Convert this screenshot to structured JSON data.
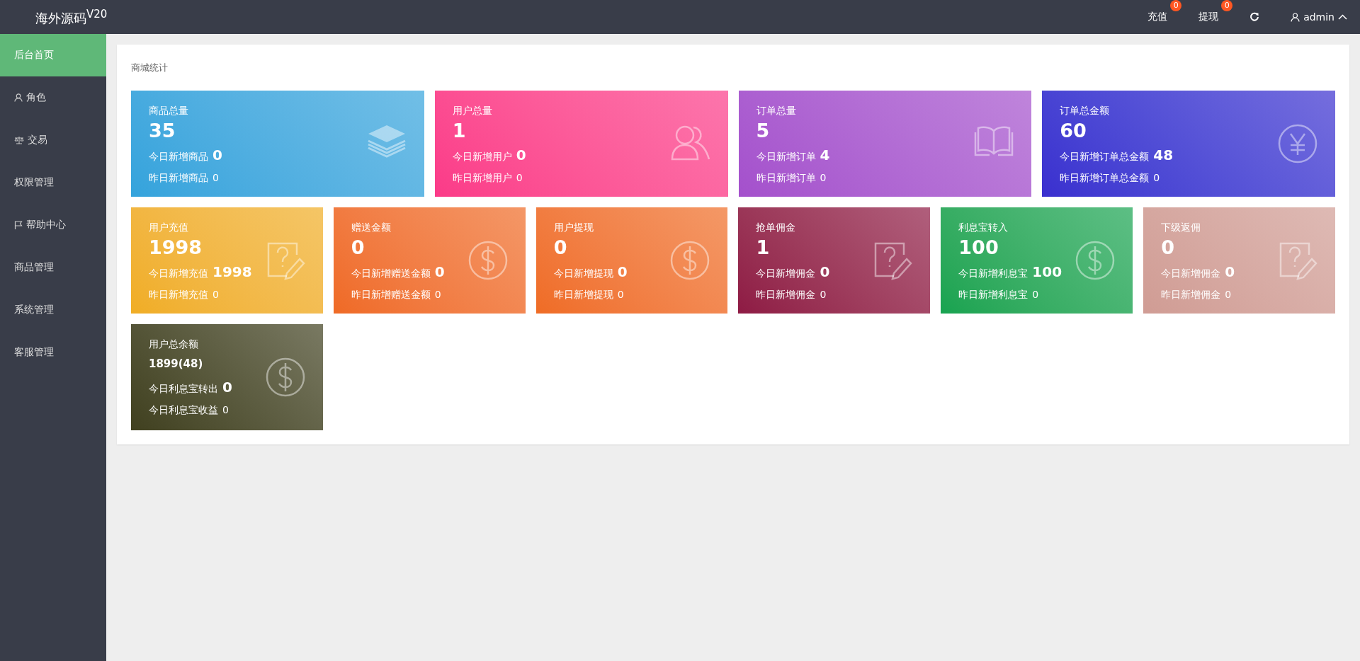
{
  "header": {
    "logo": "海外源码$^{V20}$",
    "actions": [
      {
        "label": "充值",
        "badge": "0"
      },
      {
        "label": "提现",
        "badge": "0"
      }
    ],
    "user": "admin"
  },
  "sidebar": {
    "items": [
      {
        "label": "后台首页",
        "kind": "plain",
        "selected": true
      },
      {
        "label": "角色",
        "kind": "user",
        "selected": false
      },
      {
        "label": "交易",
        "kind": "scale",
        "selected": false
      },
      {
        "label": "权限管理",
        "kind": "plain",
        "selected": false
      },
      {
        "label": "帮助中心",
        "kind": "flag",
        "selected": false
      },
      {
        "label": "商品管理",
        "kind": "plain",
        "selected": false
      },
      {
        "label": "系统管理",
        "kind": "plain",
        "selected": false
      },
      {
        "label": "客服管理",
        "kind": "plain",
        "selected": false
      }
    ]
  },
  "panel": {
    "title": "商城统计",
    "rows": [
      {
        "cards": [
          {
            "kind": "layers",
            "title": "商品总量",
            "value": "35",
            "today_label": "今日新增商品",
            "today_value": "0",
            "yesterday_label": "昨日新增商品",
            "yesterday_value": "0",
            "color": "#34a3dc"
          },
          {
            "kind": "users",
            "title": "用户总量",
            "value": "1",
            "today_label": "今日新增用户",
            "today_value": "0",
            "yesterday_label": "昨日新增用户",
            "yesterday_value": "0",
            "color": "#fb3a88"
          },
          {
            "kind": "book",
            "title": "订单总量",
            "value": "5",
            "today_label": "今日新增订单",
            "today_value": "4",
            "yesterday_label": "昨日新增订单",
            "yesterday_value": "0",
            "color": "#a450cc"
          },
          {
            "kind": "yen",
            "title": "订单总金额",
            "value": "60",
            "today_label": "今日新增订单总金额",
            "today_value": "48",
            "yesterday_label": "昨日新增订单总金额",
            "yesterday_value": "0",
            "color": "#3a2fcf"
          }
        ]
      },
      {
        "cards": [
          {
            "kind": "note",
            "title": "用户充值",
            "value": "1998",
            "today_label": "今日新增充值",
            "today_value": "1998",
            "yesterday_label": "昨日新增充值",
            "yesterday_value": "0",
            "color": "#f0ad24"
          },
          {
            "kind": "dollar",
            "title": "赠送金额",
            "value": "0",
            "today_label": "今日新增赠送金额",
            "today_value": "0",
            "yesterday_label": "昨日新增赠送金额",
            "yesterday_value": "0",
            "color": "#ef6a25"
          },
          {
            "kind": "dollar",
            "title": "用户提现",
            "value": "0",
            "today_label": "今日新增提现",
            "today_value": "0",
            "yesterday_label": "昨日新增提现",
            "yesterday_value": "0",
            "color": "#ef6c25"
          },
          {
            "kind": "note",
            "title": "抢单佣金",
            "value": "1",
            "today_label": "今日新增佣金",
            "today_value": "0",
            "yesterday_label": "昨日新增佣金",
            "yesterday_value": "0",
            "color": "#8e1a44"
          },
          {
            "kind": "dollar",
            "title": "利息宝转入",
            "value": "100",
            "today_label": "今日新增利息宝",
            "today_value": "100",
            "yesterday_label": "昨日新增利息宝",
            "yesterday_value": "0",
            "color": "#17a350"
          },
          {
            "kind": "note",
            "title": "下级返佣",
            "value": "0",
            "today_label": "今日新增佣金",
            "today_value": "0",
            "yesterday_label": "昨日新增佣金",
            "yesterday_value": "0",
            "color": "#d09c94"
          }
        ]
      },
      {
        "cards": [
          {
            "kind": "balance",
            "title": "用户总余额",
            "value": "1899(48)",
            "today_label": "今日利息宝转出",
            "today_value": "0",
            "yesterday_label": "今日利息宝收益",
            "yesterday_value": "0",
            "color": "#40401f"
          }
        ]
      }
    ]
  }
}
